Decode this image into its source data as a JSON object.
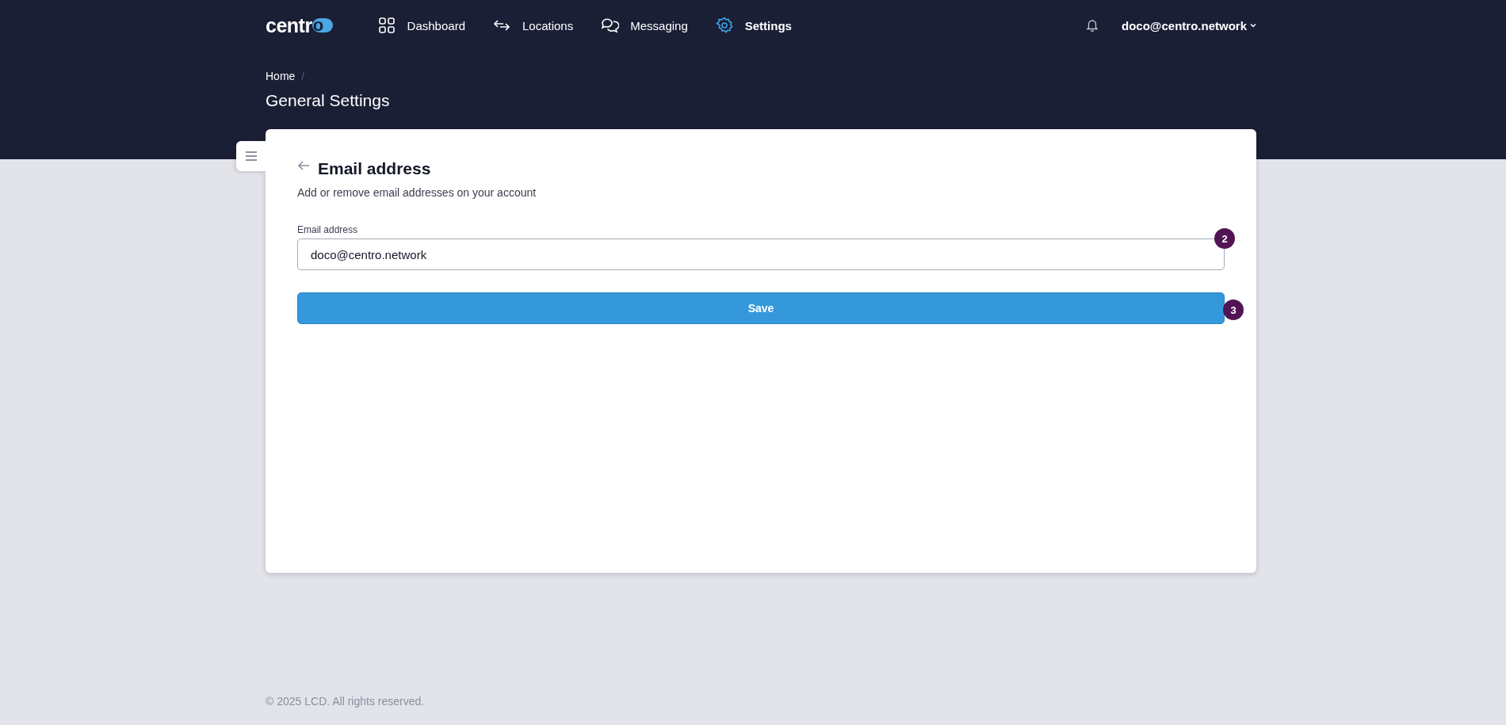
{
  "header": {
    "logo": "centro",
    "nav": [
      {
        "label": "Dashboard",
        "selected": false
      },
      {
        "label": "Locations",
        "selected": false
      },
      {
        "label": "Messaging",
        "selected": false
      },
      {
        "label": "Settings",
        "selected": true
      }
    ],
    "user": "doco@centro.network"
  },
  "breadcrumb": {
    "items": [
      "Home"
    ],
    "separator": "/"
  },
  "page_title": "General Settings",
  "card": {
    "title": "Email address",
    "subtitle": "Add or remove email addresses on your account",
    "field": {
      "label": "Email address",
      "value": "doco@centro.network",
      "badge": "2"
    },
    "button": {
      "label": "Save",
      "badge": "3"
    }
  },
  "footer": "© 2025 LCD. All rights reserved."
}
